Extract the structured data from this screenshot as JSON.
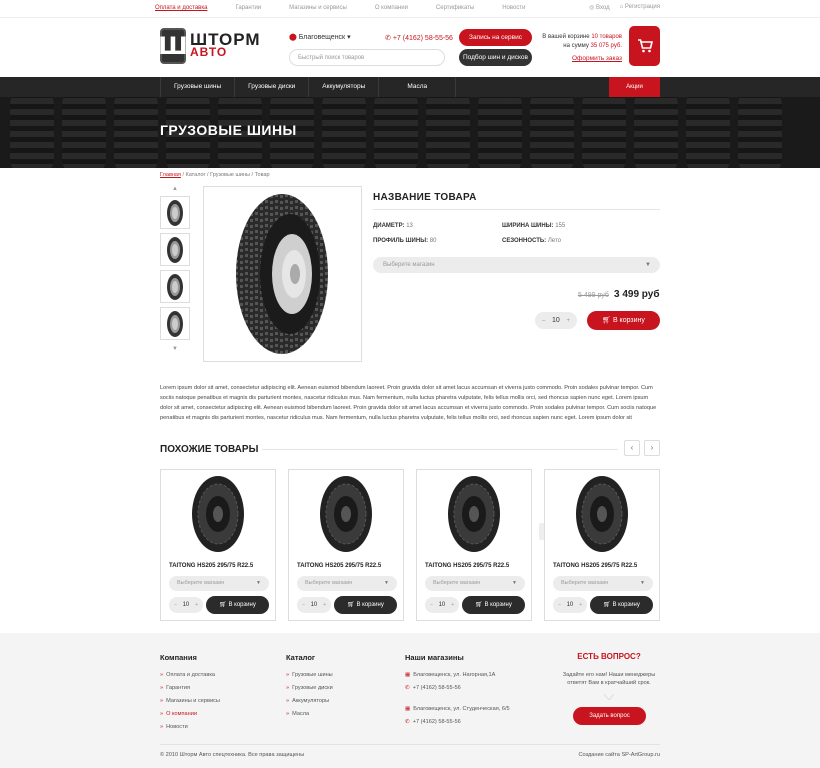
{
  "topnav": {
    "items": [
      "Оплата и доставка",
      "Гарантии",
      "Магазины и сервисы",
      "О компании",
      "Сертификаты",
      "Новости"
    ],
    "login": "Вход",
    "register": "Регистрация"
  },
  "header": {
    "logo_line1": "ШТОРМ",
    "logo_line2": "АВТО",
    "city": "Благовещенск",
    "search_placeholder": "Быстрый поиск товаров",
    "phone": "+7 (4162) 58-55-56",
    "service_button": "Запись на сервис",
    "pick_button": "Подбор шин и дисков",
    "cart_line1_prefix": "В вашей корзине ",
    "cart_items": "10 товаров",
    "cart_line2_prefix": "на сумму ",
    "cart_sum": "35 075 руб.",
    "checkout_link": "Оформить заказ"
  },
  "menu": {
    "items": [
      "Грузовые шины",
      "Грузовые диски",
      "Аккумуляторы",
      "Масла"
    ],
    "sale": "Акции"
  },
  "banner": {
    "title": "ГРУЗОВЫЕ ШИНЫ"
  },
  "breadcrumbs": {
    "home": "Главная",
    "catalog": "Каталог",
    "category": "Грузовые шины",
    "current": "Товар",
    "sep": " / "
  },
  "product": {
    "title": "НАЗВАНИЕ ТОВАРА",
    "specs": {
      "diameter_label": "ДИАМЕТР:",
      "diameter_value": "13",
      "width_label": "ШИРИНА ШИНЫ:",
      "width_value": "155",
      "profile_label": "ПРОФИЛЬ ШИНЫ:",
      "profile_value": "80",
      "season_label": "СЕЗОННОСТЬ:",
      "season_value": "Лето"
    },
    "store_placeholder": "Выберите магазин",
    "old_price": "5 499 руб",
    "price": "3 499 руб",
    "qty": "10",
    "minus": "–",
    "plus": "+",
    "cart_button": "В корзину",
    "description": "Lorem ipsum dolor sit amet, consectetur adipiscing elit. Aenean euismod bibendum laoreet. Proin gravida dolor sit amet lacus accumsan et viverra justo commodo. Proin sodales pulvinar tempor. Cum sociis natoque penatibus et magnis dis parturient montes, nascetur ridiculus mus. Nam fermentum, nulla luctus pharetra vulputate, felis tellus mollis orci, sed rhoncus sapien nunc eget. Lorem ipsum dolor sit amet, consectetur adipiscing elit. Aenean euismod bibendum laoreet. Proin gravida dolor sit amet lacus accumsan et viverra justo commodo. Proin sodales pulvinar tempor. Cum sociis natoque penatibus et magnis dis parturient montes, nascetur ridiculus mus. Nam fermentum, nulla luctus pharetra vulputate, felis tellus mollis orci, sed rhoncus sapien nunc eget. Lorem ipsum dolor sit"
  },
  "similar": {
    "title": "ПОХОЖИЕ ТОВАРЫ",
    "prev": "‹",
    "next": "›",
    "cards": [
      {
        "name": "TAITONG HS205 295/75 R22.5",
        "store": "Выберите магазин",
        "qty": "10",
        "button": "В корзину"
      },
      {
        "name": "TAITONG HS205 295/75 R22.5",
        "store": "Выберите магазин",
        "qty": "10",
        "button": "В корзину"
      },
      {
        "name": "TAITONG HS205 295/75 R22.5",
        "store": "Выберите магазин",
        "qty": "10",
        "button": "В корзину"
      },
      {
        "name": "TAITONG HS205 295/75 R22.5",
        "store": "Выберите магазин",
        "qty": "10",
        "button": "В корзину"
      }
    ]
  },
  "footer": {
    "company_title": "Компания",
    "company_links": [
      "Оплата и доставка",
      "Гарантия",
      "Магазины и сервисы",
      "О компании",
      "Новости"
    ],
    "catalog_title": "Каталог",
    "catalog_links": [
      "Грузовые шины",
      "Грузовые диски",
      "Аккумуляторы",
      "Масла"
    ],
    "stores_title": "Наши магазины",
    "store1_address": "Благовещенск, ул. Нагорная,1А",
    "store1_phone": "+7 (4162) 58-55-56",
    "store2_address": "Благовещенск, ул. Студенческая, 6/5",
    "store2_phone": "+7 (4162) 58-55-56",
    "question_title": "ЕСТЬ ВОПРОС?",
    "question_text": "Задайте его нам! Наши менеджеры ответят Вам в кратчайший срок.",
    "question_button": "Задать вопрос",
    "copyright": "© 2010 Шторм Авто спецтехника. Все права защищены",
    "credit": "Создание сайта SP-ArtGroup.ru"
  },
  "colors": {
    "accent": "#c8141e",
    "dark": "#262626"
  }
}
